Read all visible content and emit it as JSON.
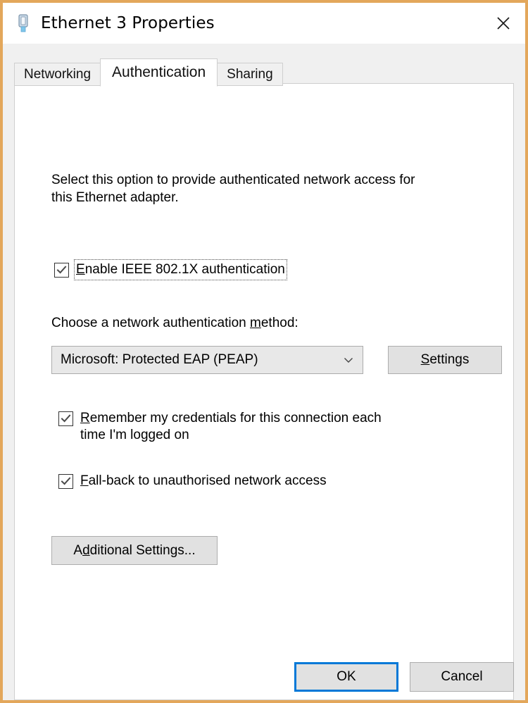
{
  "window": {
    "title": "Ethernet 3 Properties",
    "icon": "network-adapter-icon",
    "close_label": "✕",
    "border_color": "#E3A75B",
    "background_color": "#F0F0F0"
  },
  "tabs": [
    {
      "label": "Networking",
      "selected": false
    },
    {
      "label": "Authentication",
      "selected": true
    },
    {
      "label": "Sharing",
      "selected": false
    }
  ],
  "panel": {
    "intro_line1": "Select this option to provide authenticated network access for",
    "intro_line2": "this Ethernet adapter.",
    "enable_checkbox": {
      "accel": "E",
      "label_rest": "nable IEEE 802.1X authentication",
      "checked": true,
      "focused": true
    },
    "combo_label": {
      "prefix": "Choose a network authentication ",
      "accel": "m",
      "suffix": "ethod:"
    },
    "combo": {
      "value": "Microsoft: Protected EAP (PEAP)",
      "arrow_icon": "chevron-down-icon"
    },
    "settings_button": {
      "accel": "S",
      "label_rest": "ettings"
    },
    "remember_checkbox": {
      "accel": "R",
      "label_line1_rest": "emember my credentials for this connection each",
      "label_line2": "time I'm logged on",
      "checked": true
    },
    "fallback_checkbox": {
      "accel": "F",
      "label_rest": "all-back to unauthorised network access",
      "checked": true
    },
    "additional_button": {
      "prefix": "A",
      "accel": "d",
      "suffix": "ditional Settings..."
    }
  },
  "footer": {
    "ok_label": "OK",
    "cancel_label": "Cancel",
    "default_button_accent": "#0078D7"
  }
}
